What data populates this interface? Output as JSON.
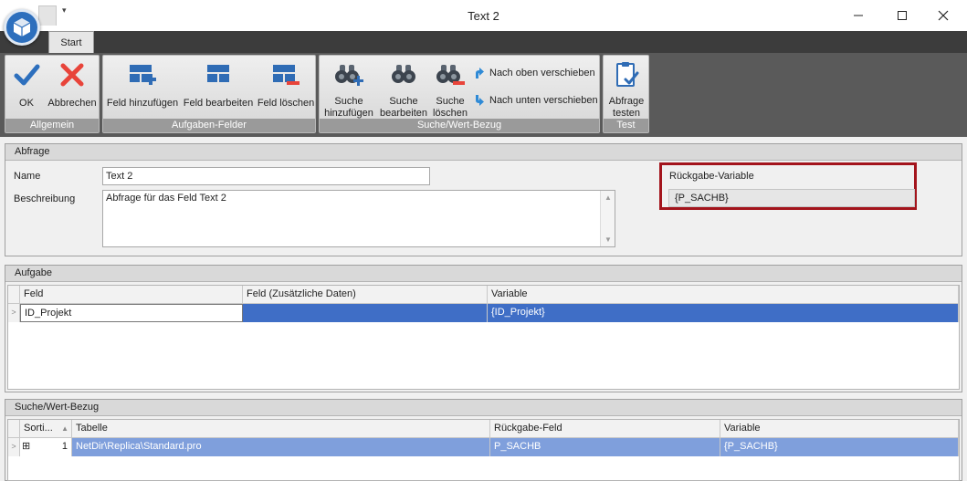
{
  "window": {
    "title": "Text 2",
    "qat_arrow": "▾",
    "minimize": "—",
    "maximize": "☐",
    "close": "✕"
  },
  "ribbon": {
    "tab": "Start",
    "groups": {
      "allgemein": {
        "label": "Allgemein",
        "ok": "OK",
        "abbrechen": "Abbrechen"
      },
      "aufgaben_felder": {
        "label": "Aufgaben-Felder",
        "feld_hinzufuegen": "Feld hinzufügen",
        "feld_bearbeiten": "Feld bearbeiten",
        "feld_loeschen": "Feld löschen"
      },
      "suche": {
        "label": "Suche/Wert-Bezug",
        "suche_hinzufuegen_1": "Suche",
        "suche_hinzufuegen_2": "hinzufügen",
        "suche_bearbeiten_1": "Suche",
        "suche_bearbeiten_2": "bearbeiten",
        "suche_loeschen_1": "Suche",
        "suche_loeschen_2": "löschen",
        "nach_oben": "Nach oben verschieben",
        "nach_unten": "Nach unten verschieben"
      },
      "test": {
        "label": "Test",
        "abfrage_testen_1": "Abfrage",
        "abfrage_testen_2": "testen"
      }
    }
  },
  "abfrage": {
    "title": "Abfrage",
    "name_label": "Name",
    "name_value": "Text 2",
    "beschreibung_label": "Beschreibung",
    "beschreibung_value": "Abfrage für das Feld Text 2",
    "rueckgabe_label": "Rückgabe-Variable",
    "rueckgabe_value": "{P_SACHB}"
  },
  "aufgabe": {
    "title": "Aufgabe",
    "columns": [
      "Feld",
      "Feld (Zusätzliche Daten)",
      "Variable"
    ],
    "rows": [
      {
        "feld": "ID_Projekt",
        "zusatz": "",
        "variable": "{ID_Projekt}"
      }
    ]
  },
  "suche": {
    "title": "Suche/Wert-Bezug",
    "columns": [
      "Sorti...",
      "Tabelle",
      "Rückgabe-Feld",
      "Variable"
    ],
    "sort_indicator": "▲",
    "rows": [
      {
        "expand": "⊞",
        "sort": "1",
        "tabelle": "NetDir\\Replica\\Standard.pro",
        "rueckgabe_feld": "P_SACHB",
        "variable": "{P_SACHB}"
      }
    ]
  },
  "colors": {
    "selection": "#3f6ec6",
    "selection_light": "#7f9fdc",
    "highlight_border": "#a3141c",
    "ok_check": "#2d6fbd",
    "cancel_x": "#e8443a"
  },
  "icons": [
    "app-logo-icon",
    "check-icon",
    "x-icon",
    "grid-add-icon",
    "grid-edit-icon",
    "grid-delete-icon",
    "binoculars-add-icon",
    "binoculars-icon",
    "binoculars-delete-icon",
    "arrow-up-icon",
    "arrow-down-icon",
    "clipboard-check-icon"
  ]
}
